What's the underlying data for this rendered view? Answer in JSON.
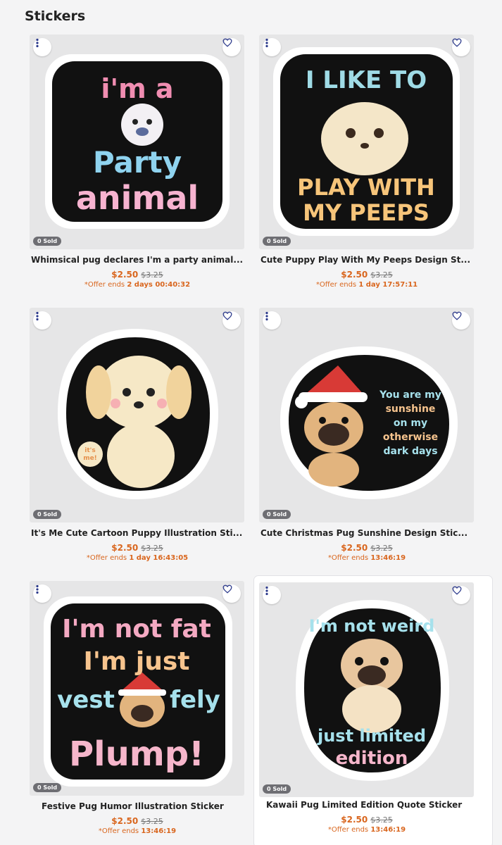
{
  "page_title": "Stickers",
  "products": [
    {
      "title": "Whimsical pug declares I'm a party animal...",
      "price": "$2.50",
      "old_price": "$3.25",
      "offer_prefix": "*Offer ends",
      "offer_time": "2 days 00:40:32",
      "sold": "0 Sold",
      "art": [
        "i'm a",
        "Party",
        "animal"
      ]
    },
    {
      "title": "Cute Puppy Play With My Peeps Design St...",
      "price": "$2.50",
      "old_price": "$3.25",
      "offer_prefix": "*Offer ends",
      "offer_time": "1 day 17:57:11",
      "sold": "0 Sold",
      "art": [
        "I LIKE TO",
        "PLAY WITH",
        "MY PEEPS"
      ]
    },
    {
      "title": "It's Me Cute Cartoon Puppy Illustration Sti...",
      "price": "$2.50",
      "old_price": "$3.25",
      "offer_prefix": "*Offer ends",
      "offer_time": "1 day 16:43:05",
      "sold": "0 Sold",
      "art": [
        "it's",
        "me!"
      ]
    },
    {
      "title": "Cute Christmas Pug Sunshine Design Stic...",
      "price": "$2.50",
      "old_price": "$3.25",
      "offer_prefix": "*Offer ends",
      "offer_time": "13:46:19",
      "sold": "0 Sold",
      "art": [
        "You are my",
        "sunshine",
        "on my",
        "otherwise",
        "dark days"
      ]
    },
    {
      "title": "Festive Pug Humor Illustration Sticker",
      "price": "$2.50",
      "old_price": "$3.25",
      "offer_prefix": "*Offer ends",
      "offer_time": "13:46:19",
      "sold": "0 Sold",
      "art": [
        "I'm not fat",
        "I'm just",
        "vest",
        "fely",
        "Plump!"
      ]
    },
    {
      "title": "Kawaii Pug Limited Edition Quote Sticker",
      "price": "$2.50",
      "old_price": "$3.25",
      "offer_prefix": "*Offer ends",
      "offer_time": "13:46:19",
      "sold": "0 Sold",
      "art": [
        "I'm not weird",
        "just limited",
        "edition"
      ]
    }
  ],
  "colors": {
    "accent_price": "#d9661e",
    "badge": "#6e6e73",
    "icon": "#2c3a8c"
  },
  "icons": {
    "menu": "more-vertical-icon",
    "favorite": "heart-outline-icon"
  }
}
